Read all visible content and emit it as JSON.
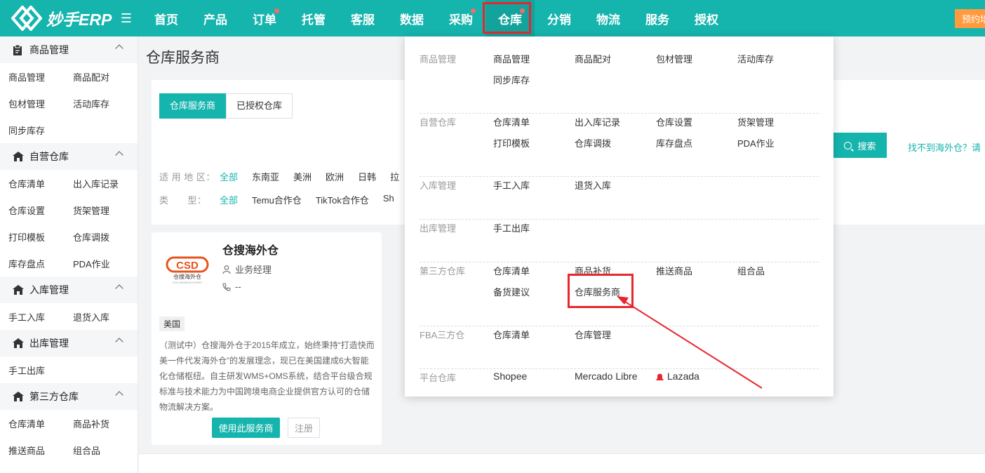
{
  "app": {
    "logo_text": "妙手ERP",
    "reserve_label": "预约培训"
  },
  "nav": {
    "items": [
      {
        "label": "首页",
        "dot": false
      },
      {
        "label": "产品",
        "dot": false
      },
      {
        "label": "订单",
        "dot": true
      },
      {
        "label": "托管",
        "dot": false
      },
      {
        "label": "客服",
        "dot": false
      },
      {
        "label": "数据",
        "dot": false
      },
      {
        "label": "采购",
        "dot": true
      },
      {
        "label": "仓库",
        "dot": true
      },
      {
        "label": "分销",
        "dot": false
      },
      {
        "label": "物流",
        "dot": false
      },
      {
        "label": "服务",
        "dot": false
      },
      {
        "label": "授权",
        "dot": false
      }
    ],
    "active": "仓库"
  },
  "sidebar": {
    "groups": [
      {
        "title": "商品管理",
        "icon": "clipboard-icon",
        "rows": [
          [
            "商品管理",
            "商品配对"
          ],
          [
            "包材管理",
            "活动库存"
          ],
          [
            "同步库存"
          ]
        ]
      },
      {
        "title": "自营仓库",
        "icon": "house-icon",
        "rows": [
          [
            "仓库清单",
            "出入库记录"
          ],
          [
            "仓库设置",
            "货架管理"
          ],
          [
            "打印模板",
            "仓库调拨"
          ],
          [
            "库存盘点",
            "PDA作业"
          ]
        ]
      },
      {
        "title": "入库管理",
        "icon": "house-icon",
        "rows": [
          [
            "手工入库",
            "退货入库"
          ]
        ]
      },
      {
        "title": "出库管理",
        "icon": "house-icon",
        "rows": [
          [
            "手工出库"
          ]
        ]
      },
      {
        "title": "第三方仓库",
        "icon": "house-icon",
        "rows": [
          [
            "仓库清单",
            "商品补货"
          ],
          [
            "推送商品",
            "组合品"
          ]
        ]
      }
    ]
  },
  "main": {
    "page_title": "仓库服务商",
    "tabs": [
      {
        "label": "仓库服务商",
        "active": true
      },
      {
        "label": "已授权仓库",
        "active": false
      }
    ],
    "search_label": "搜索",
    "notfound_text": "找不到海外仓？请",
    "filters": {
      "region_label": "适 用 地 区：",
      "region_options": [
        "全部",
        "东南亚",
        "美洲",
        "欧洲",
        "日韩",
        "拉"
      ],
      "type_label": "类　　型：",
      "type_options": [
        "全部",
        "Temu合作仓",
        "TikTok合作仓",
        "Sh"
      ]
    },
    "card": {
      "name": "仓搜海外仓",
      "manager": "业务经理",
      "phone": "--",
      "tag": "美国",
      "description": "（测试中）仓搜海外仓于2015年成立，始终秉持“打造快而美一件代发海外仓”的发展理念，现已在美国建成6大智能化仓储枢纽。自主研发WMS+OMS系统，结合平台级合规标准与技术能力为中国跨境电商企业提供官方认可的仓储物流解决方案。",
      "use_label": "使用此服务商",
      "register_label": "注册",
      "logo_text": "CSD",
      "logo_sub": "仓搜海外仓",
      "logo_tiny": "CSD OVERSEAS EXPERT"
    }
  },
  "dropdown": {
    "sections": [
      {
        "label": "商品管理",
        "items": [
          "商品管理",
          "商品配对",
          "包材管理",
          "活动库存",
          "同步库存"
        ]
      },
      {
        "label": "自营仓库",
        "items": [
          "仓库清单",
          "出入库记录",
          "仓库设置",
          "货架管理",
          "打印模板",
          "仓库调拨",
          "库存盘点",
          "PDA作业"
        ]
      },
      {
        "label": "入库管理",
        "items": [
          "手工入库",
          "退货入库"
        ]
      },
      {
        "label": "出库管理",
        "items": [
          "手工出库"
        ]
      },
      {
        "label": "第三方仓库",
        "items": [
          "仓库清单",
          "商品补货",
          "推送商品",
          "组合品",
          "备货建议",
          "仓库服务商"
        ]
      },
      {
        "label": "FBA三方仓",
        "items": [
          "仓库清单",
          "仓库管理"
        ]
      },
      {
        "label": "平台仓库",
        "items": [
          "Shopee",
          "Mercado Libre",
          "Lazada"
        ]
      }
    ]
  },
  "colors": {
    "brand": "#15b4ad",
    "highlight": "#e8262d",
    "dot": "#f56c6c",
    "reserve": "#ff9b3e"
  }
}
